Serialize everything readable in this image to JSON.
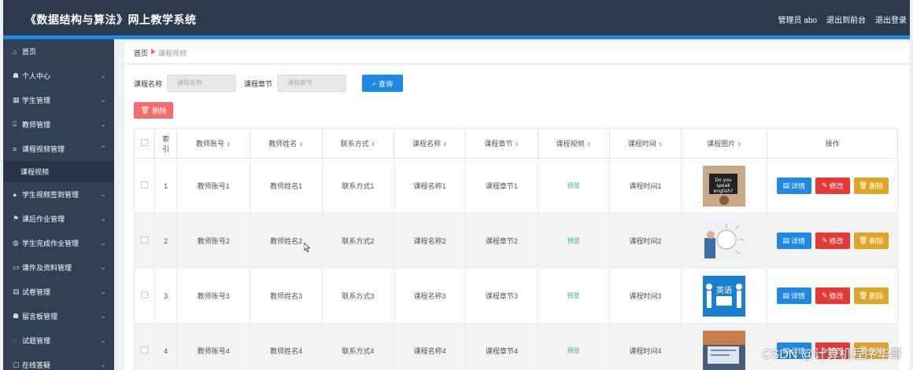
{
  "app": {
    "title": "《数据结构与算法》网上教学系统"
  },
  "header": {
    "admin": "管理员 abo",
    "back_front": "退出到前台",
    "logout": "退出登录"
  },
  "sidebar": {
    "items": [
      {
        "label": "首页",
        "icon": "home-icon",
        "glyph": "⌂"
      },
      {
        "label": "个人中心",
        "icon": "user-icon",
        "glyph": "☗"
      },
      {
        "label": "学生管理",
        "icon": "grid-icon",
        "glyph": "▦"
      },
      {
        "label": "教师管理",
        "icon": "bank-icon",
        "glyph": "⌸"
      },
      {
        "label": "课程视频管理",
        "icon": "list-icon",
        "glyph": "≡"
      },
      {
        "label": "课程视频",
        "sub": true
      },
      {
        "label": "学生视频签到管理",
        "icon": "pin-icon",
        "glyph": "●"
      },
      {
        "label": "课后作业管理",
        "icon": "flag-icon",
        "glyph": "⚑"
      },
      {
        "label": "学生完成作业管理",
        "icon": "globe-icon",
        "glyph": "◍"
      },
      {
        "label": "课件及资料管理",
        "icon": "folder-icon",
        "glyph": "▭"
      },
      {
        "label": "试卷管理",
        "icon": "paper-icon",
        "glyph": "▤"
      },
      {
        "label": "留言板管理",
        "icon": "person-icon",
        "glyph": "☗"
      },
      {
        "label": "试题管理",
        "icon": "bulb-icon",
        "glyph": "◌"
      },
      {
        "label": "在线答疑",
        "icon": "chat-icon",
        "glyph": "▢"
      }
    ]
  },
  "breadcrumb": {
    "home": "首页",
    "sep": "🢖",
    "current": "课程视频"
  },
  "search": {
    "course_name_label": "课程名称",
    "course_name_placeholder": "课程名称",
    "chapter_label": "课程章节",
    "chapter_placeholder": "课程章节",
    "button": "查询"
  },
  "actions": {
    "delete": "删除"
  },
  "table": {
    "headers": [
      "索引",
      "教师账号",
      "教师姓名",
      "联系方式",
      "课程名称",
      "课程章节",
      "课程视频",
      "课程时间",
      "课程图片",
      "操作"
    ],
    "sort_glyph": "⇕",
    "preview": "预览",
    "ops": {
      "detail": "详情",
      "edit": "修改",
      "delete": "删除"
    },
    "rows": [
      {
        "idx": "1",
        "acct": "教师账号1",
        "name": "教师姓名1",
        "contact": "联系方式1",
        "course": "课程名称1",
        "chapter": "课程章节1",
        "time": "课程时间1"
      },
      {
        "idx": "2",
        "acct": "教师账号2",
        "name": "教师姓名2",
        "contact": "联系方式2",
        "course": "课程名称2",
        "chapter": "课程章节2",
        "time": "课程时间2"
      },
      {
        "idx": "3",
        "acct": "教师账号3",
        "name": "教师姓名3",
        "contact": "联系方式3",
        "course": "课程名称3",
        "chapter": "课程章节3",
        "time": "课程时间3"
      },
      {
        "idx": "4",
        "acct": "教师账号4",
        "name": "教师姓名4",
        "contact": "联系方式4",
        "course": "课程名称4",
        "chapter": "课程章节4",
        "time": "课程时间4"
      }
    ]
  },
  "watermark": "CSDN @计算机程序华哥"
}
